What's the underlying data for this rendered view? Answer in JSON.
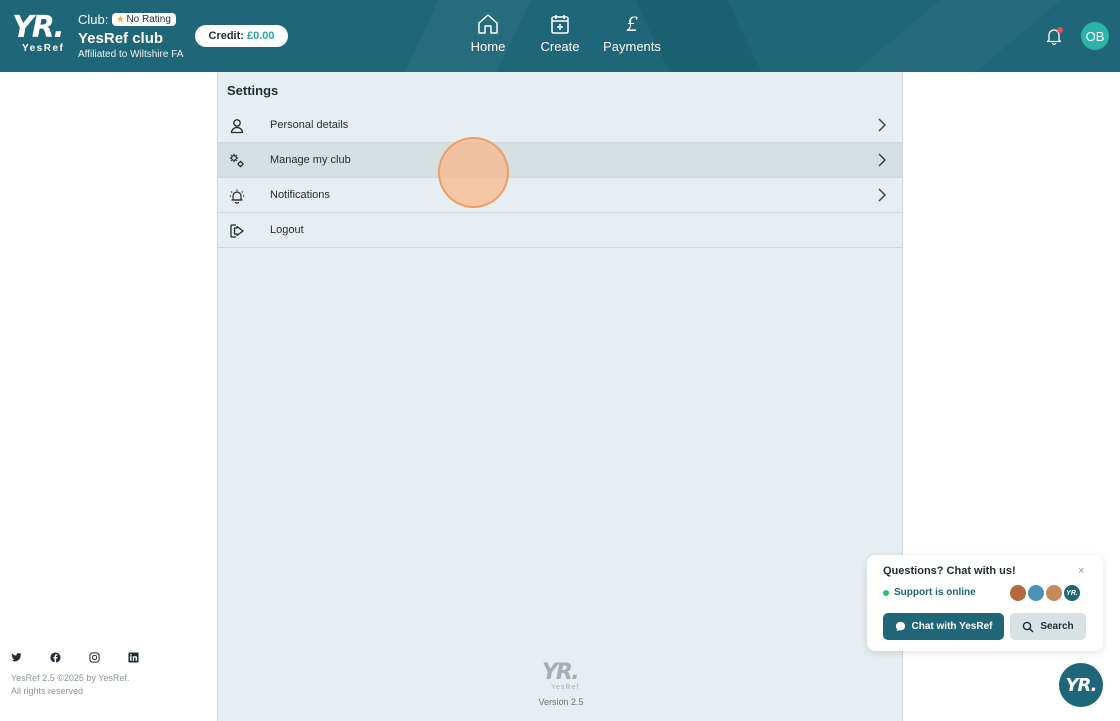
{
  "header": {
    "logo": {
      "text": "YR.",
      "sub": "YesRef"
    },
    "club_label": "Club:",
    "rating_badge": "No Rating",
    "club_name": "YesRef club",
    "affiliation": "Affiliated to Wiltshire FA",
    "credit_label": "Credit:",
    "credit_amount": "£0.00",
    "nav": [
      {
        "label": "Home",
        "icon": "home-icon"
      },
      {
        "label": "Create",
        "icon": "calendar-plus-icon"
      },
      {
        "label": "Payments",
        "icon": "pound-icon"
      }
    ],
    "pound_glyph": "£",
    "avatar_initials": "OB"
  },
  "settings": {
    "title": "Settings",
    "items": [
      {
        "label": "Personal details",
        "icon": "person-icon",
        "has_chevron": true
      },
      {
        "label": "Manage my club",
        "icon": "gears-icon",
        "has_chevron": true,
        "active": true
      },
      {
        "label": "Notifications",
        "icon": "alarm-bell-icon",
        "has_chevron": true
      },
      {
        "label": "Logout",
        "icon": "logout-icon",
        "has_chevron": false
      }
    ],
    "footer_logo": {
      "text": "YR.",
      "sub": "YesRef"
    },
    "version": "Version 2.5"
  },
  "footer": {
    "social": [
      "twitter-icon",
      "facebook-icon",
      "instagram-icon",
      "linkedin-icon"
    ],
    "copyright_line1": "YesRef 2.5 ©2025 by YesRef.",
    "copyright_line2": "All rights reserved"
  },
  "chat": {
    "title": "Questions? Chat with us!",
    "close": "×",
    "status": "Support is online",
    "agent_badge": "YR.",
    "chat_button": "Chat with YesRef",
    "search_button": "Search",
    "launcher": "YR."
  },
  "colors": {
    "header_bg": "#1e6678",
    "accent_teal": "#2ab3a6",
    "panel_bg": "#e6eef1",
    "online": "#2ec16d"
  }
}
